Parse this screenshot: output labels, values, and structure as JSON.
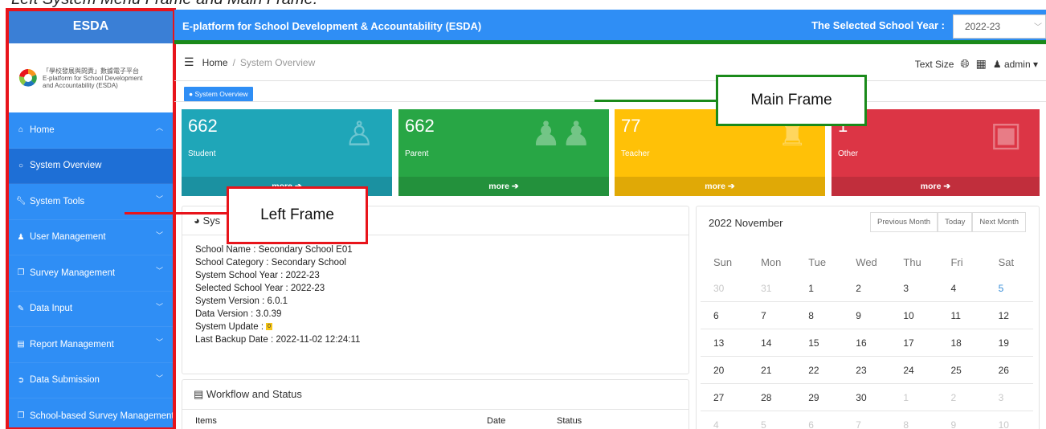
{
  "caption": "Left System Menu Frame and Main Frame.",
  "sidebar": {
    "title": "ESDA",
    "logo_lines": [
      "「學校發展與問責」數據電子平台",
      "E-platform for School Development",
      "and Accountability (ESDA)"
    ],
    "items": [
      {
        "label": "Home",
        "icon": "home-icon",
        "chevron": "^"
      },
      {
        "label": "System Overview",
        "icon": "circle-icon"
      },
      {
        "label": "System Tools",
        "icon": "wrench-icon",
        "chevron": "v"
      },
      {
        "label": "User Management",
        "icon": "user-icon",
        "chevron": "v"
      },
      {
        "label": "Survey Management",
        "icon": "copy-icon",
        "chevron": "v"
      },
      {
        "label": "Data Input",
        "icon": "edit-icon",
        "chevron": "v"
      },
      {
        "label": "Report Management",
        "icon": "file-icon",
        "chevron": "v"
      },
      {
        "label": "Data Submission",
        "icon": "signin-icon",
        "chevron": "v"
      },
      {
        "label": "School-based Survey Management",
        "icon": "copy-icon"
      }
    ]
  },
  "topbar": {
    "title": "E-platform for School Development & Accountability (ESDA)",
    "school_year_label": "The Selected School Year :",
    "school_year_value": "2022-23"
  },
  "breadcrumb": {
    "home": "Home",
    "separator": "/",
    "current": "System Overview"
  },
  "tools": {
    "text_size": "Text Size",
    "user": "admin"
  },
  "tab": {
    "label": "System Overview"
  },
  "cards": [
    {
      "value": "662",
      "label": "Student",
      "more": "more",
      "color": "#1fa6b8",
      "icon": "child-icon"
    },
    {
      "value": "662",
      "label": "Parent",
      "more": "more",
      "color": "#28a645",
      "icon": "users-icon"
    },
    {
      "value": "77",
      "label": "Teacher",
      "more": "more",
      "color": "#ffc107",
      "icon": "teacher-icon"
    },
    {
      "value": "1",
      "label": "Other",
      "more": "more",
      "color": "#dc3545",
      "icon": "contact-book-icon"
    }
  ],
  "system_panel": {
    "title": "Sys",
    "rows": [
      "School Name : Secondary School E01",
      "School Category : Secondary School",
      "System School Year : 2022-23",
      "Selected School Year : 2022-23",
      "System Version : 6.0.1",
      "Data Version : 3.0.39",
      "System Update :",
      "Last Backup Date : 2022-11-02 12:24:11"
    ],
    "update_badge": "0"
  },
  "workflow": {
    "title": "Workflow and Status",
    "columns": [
      "Items",
      "Date",
      "Status"
    ]
  },
  "calendar": {
    "title": "2022 November",
    "buttons": [
      "Previous Month",
      "Today",
      "Next Month"
    ],
    "weekdays": [
      "Sun",
      "Mon",
      "Tue",
      "Wed",
      "Thu",
      "Fri",
      "Sat"
    ],
    "weeks": [
      [
        "30",
        "31",
        "1",
        "2",
        "3",
        "4",
        "5"
      ],
      [
        "6",
        "7",
        "8",
        "9",
        "10",
        "11",
        "12"
      ],
      [
        "13",
        "14",
        "15",
        "16",
        "17",
        "18",
        "19"
      ],
      [
        "20",
        "21",
        "22",
        "23",
        "24",
        "25",
        "26"
      ],
      [
        "27",
        "28",
        "29",
        "30",
        "1",
        "2",
        "3"
      ],
      [
        "4",
        "5",
        "6",
        "7",
        "8",
        "9",
        "10"
      ]
    ]
  },
  "callouts": {
    "main": "Main Frame",
    "left": "Left Frame"
  },
  "colors": {
    "primary": "#2f8ef5",
    "frame_red": "#e8141b",
    "frame_green": "#1a8a1a"
  }
}
